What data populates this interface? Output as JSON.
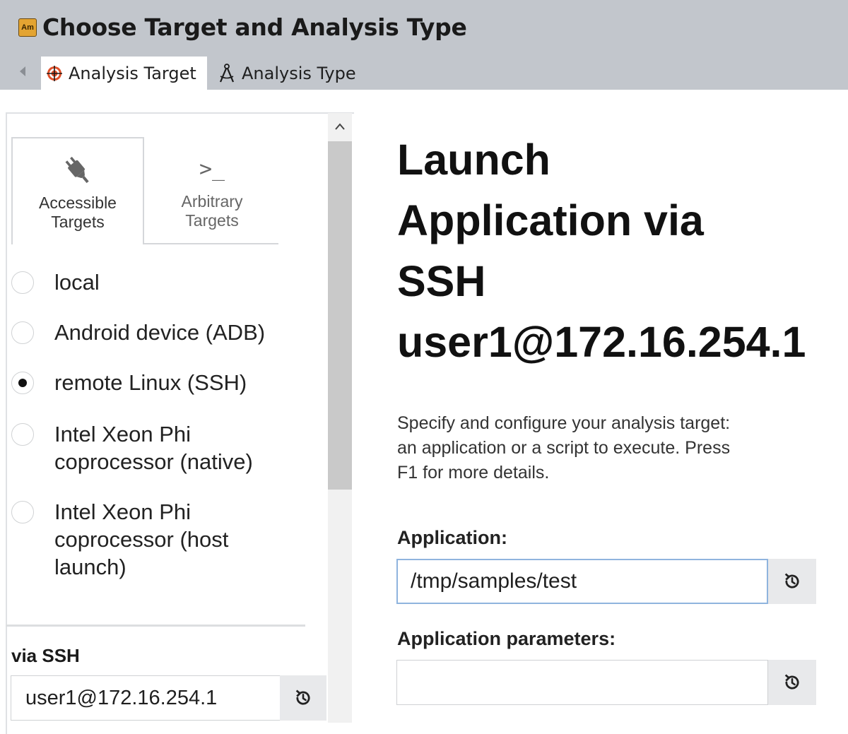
{
  "window": {
    "title": "Choose Target and Analysis Type",
    "app_icon_text": "Am"
  },
  "tabs": [
    {
      "label": "Analysis Target",
      "icon": "target-icon",
      "active": true
    },
    {
      "label": "Analysis Type",
      "icon": "compass-icon",
      "active": false
    }
  ],
  "target_tabs": [
    {
      "label_line1": "Accessible",
      "label_line2": "Targets",
      "icon": "plug-icon",
      "selected": true
    },
    {
      "label_line1": "Arbitrary",
      "label_line2": "Targets",
      "icon": "terminal-prompt-icon",
      "glyph": ">_",
      "selected": false
    }
  ],
  "targets": [
    {
      "lines": [
        "local"
      ],
      "checked": false
    },
    {
      "lines": [
        "Android device (ADB)"
      ],
      "checked": false
    },
    {
      "lines": [
        "remote Linux (SSH)"
      ],
      "checked": true
    },
    {
      "lines": [
        "Intel Xeon Phi",
        "coprocessor (native)"
      ],
      "checked": false
    },
    {
      "lines": [
        "Intel Xeon Phi",
        "coprocessor (host",
        "launch)"
      ],
      "checked": false
    }
  ],
  "ssh": {
    "label": "via SSH",
    "value": "user1@172.16.254.1"
  },
  "main": {
    "heading_lines": [
      "Launch",
      "Application via",
      "SSH",
      "user1@172.16.254.1"
    ],
    "description_lines": [
      "Specify and configure your analysis target:",
      "an application or a script to execute. Press",
      "F1 for more details."
    ],
    "application_label": "Application:",
    "application_value": "/tmp/samples/test",
    "parameters_label": "Application parameters:",
    "parameters_value": ""
  },
  "colors": {
    "header_bg": "#c2c6cc",
    "focus_border": "#8fb4de",
    "target_icon": "#e0502a"
  }
}
